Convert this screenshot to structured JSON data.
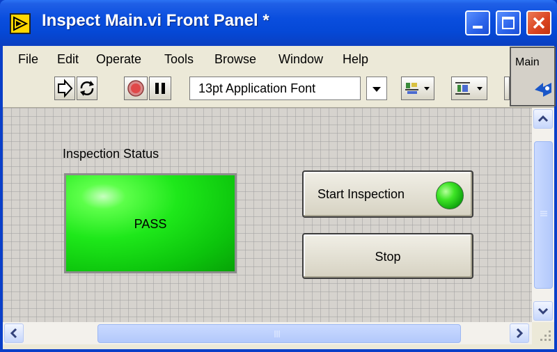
{
  "window": {
    "title": "Inspect Main.vi Front Panel *",
    "controls": [
      "minimize-icon",
      "maximize-icon",
      "close-icon"
    ]
  },
  "menu": {
    "file": "File",
    "edit": "Edit",
    "operate": "Operate",
    "tools": "Tools",
    "browse": "Browse",
    "window": "Window",
    "help": "Help"
  },
  "toolbar": {
    "run_icon": "run-arrow-icon",
    "run_continuous_icon": "run-continuously-icon",
    "abort_icon": "abort-icon",
    "pause_icon": "pause-icon",
    "font": "13pt Application Font",
    "align_icon": "align-objects-icon",
    "distribute_icon": "distribute-objects-icon"
  },
  "connector_pane": {
    "label": "Main"
  },
  "panel": {
    "status_label": "Inspection Status",
    "status_value": "PASS",
    "status_color": "#1ee81a",
    "start_button": "Start Inspection",
    "start_led_color": "#3ee526",
    "stop_button": "Stop"
  },
  "colors": {
    "titlebar": "#0a4ede",
    "canvas": "#d6d3ce",
    "close": "#d9431f"
  }
}
